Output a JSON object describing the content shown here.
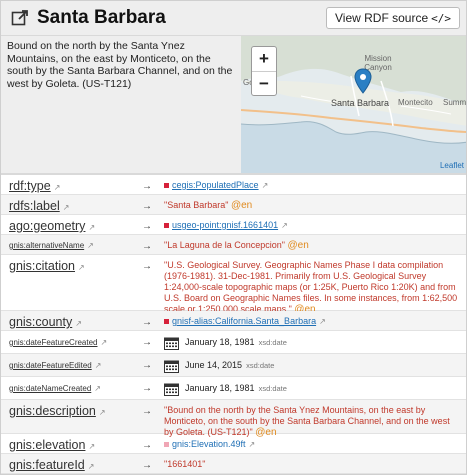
{
  "header": {
    "title": "Santa Barbara",
    "rdf_button": "View RDF source",
    "rdf_button_code": "</>"
  },
  "summary": "Bound on the north by the Santa Ynez Mountains, on the east by Monticeto, on the south by the Santa Barbara Channel, and on the west by Goleta. (US-T121)",
  "map": {
    "zoom_in": "+",
    "zoom_out": "−",
    "attribution": "Leaflet",
    "labels": {
      "goleta": "Goleta",
      "mission_canyon": "Mission Canyon",
      "santa_barbara": "Santa Barbara",
      "montecito": "Montecito",
      "summerland": "Summe"
    }
  },
  "rows": [
    {
      "prop": "rdf:type",
      "value": "cegis:PopulatedPlace"
    },
    {
      "prop": "rdfs:label",
      "value": "\"Santa Barbara\"",
      "lang": "@en"
    },
    {
      "prop": "ago:geometry",
      "value": "usgeo-point:gnisf.1661401"
    },
    {
      "prop": "gnis:alternativeName",
      "value": "\"La Laguna de la Concepcion\"",
      "lang": "@en"
    },
    {
      "prop": "gnis:citation",
      "value": "\"U.S. Geological Survey. Geographic Names Phase I data compilation (1976-1981). 31-Dec-1981. Primarily from U.S. Geological Survey 1:24,000-scale topographic maps (or 1:25K, Puerto Rico 1:20K) and from U.S. Board on Geographic Names files. In some instances, from 1:62,500 scale or 1:250,000 scale maps.\"",
      "lang": "@en"
    },
    {
      "prop": "gnis:county",
      "value": "gnisf-alias:California.Santa_Barbara"
    },
    {
      "prop": "gnis:dateFeatureCreated",
      "value": "January 18, 1981",
      "dtype": "xsd:date"
    },
    {
      "prop": "gnis:dateFeatureEdited",
      "value": "June 14, 2015",
      "dtype": "xsd:date"
    },
    {
      "prop": "gnis:dateNameCreated",
      "value": "January 18, 1981",
      "dtype": "xsd:date"
    },
    {
      "prop": "gnis:description",
      "value": "\"Bound on the north by the Santa Ynez Mountains, on the east by Monticeto, on the south by the Santa Barbara Channel, and on the west by Goleta. (US-T121)\"",
      "lang": "@en"
    },
    {
      "prop": "gnis:elevation",
      "value": "gnis:Elevation.49ft"
    },
    {
      "prop": "gnis:featureId",
      "value": "\"1661401\""
    }
  ],
  "arrow": "→",
  "colors": {
    "literal": "#c0392b",
    "link": "#1f6fb5",
    "lang": "#e08a1e",
    "red_square": "#d6213a",
    "pink_square": "#f0a6b5"
  }
}
